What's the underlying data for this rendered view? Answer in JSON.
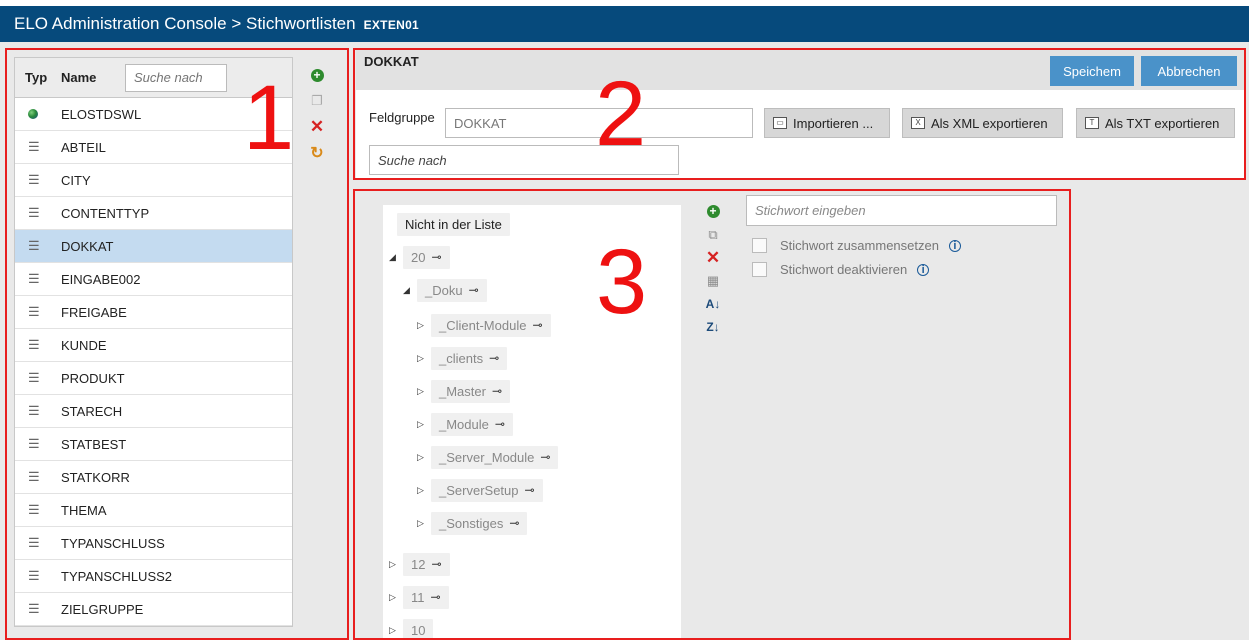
{
  "title": {
    "main": "ELO Administration Console > Stichwortlisten",
    "tenant": "EXTEN01"
  },
  "annotations": {
    "n1": "1",
    "n2": "2",
    "n3": "3"
  },
  "list": {
    "col_type": "Typ",
    "col_name": "Name",
    "search_placeholder": "Suche nach",
    "items": [
      {
        "label": "ELOSTDSWL",
        "icon": "globe-icon"
      },
      {
        "label": "ABTEIL",
        "icon": "list-icon"
      },
      {
        "label": "CITY",
        "icon": "list-icon"
      },
      {
        "label": "CONTENTTYP",
        "icon": "list-icon"
      },
      {
        "label": "DOKKAT",
        "icon": "list-icon",
        "selected": true
      },
      {
        "label": "EINGABE002",
        "icon": "list-icon"
      },
      {
        "label": "FREIGABE",
        "icon": "list-icon"
      },
      {
        "label": "KUNDE",
        "icon": "list-icon"
      },
      {
        "label": "PRODUKT",
        "icon": "list-icon"
      },
      {
        "label": "STARECH",
        "icon": "list-icon"
      },
      {
        "label": "STATBEST",
        "icon": "list-icon"
      },
      {
        "label": "STATKORR",
        "icon": "list-icon"
      },
      {
        "label": "THEMA",
        "icon": "list-icon"
      },
      {
        "label": "TYPANSCHLUSS",
        "icon": "list-icon"
      },
      {
        "label": "TYPANSCHLUSS2",
        "icon": "list-icon"
      },
      {
        "label": "ZIELGRUPPE",
        "icon": "list-icon"
      }
    ],
    "tools": [
      "add-icon",
      "copy-icon",
      "delete-icon",
      "refresh-icon"
    ]
  },
  "header": {
    "title": "DOKKAT",
    "save": "Speichem",
    "cancel": "Abbrechen",
    "fieldgroup_label": "Feldgruppe",
    "fieldgroup_value": "DOKKAT",
    "import": "Importieren ...",
    "export_xml": "Als XML exportieren",
    "export_txt": "Als TXT exportieren",
    "search_placeholder": "Suche nach"
  },
  "tree": {
    "not_in_list": "Nicht in der Liste",
    "nodes": [
      {
        "label": "20",
        "expanded": true
      },
      {
        "label": "_Doku",
        "expanded": true
      },
      {
        "label": "_Client-Module"
      },
      {
        "label": "_clients"
      },
      {
        "label": "_Master"
      },
      {
        "label": "_Module"
      },
      {
        "label": "_Server_Module"
      },
      {
        "label": "_ServerSetup"
      },
      {
        "label": "_Sonstiges"
      },
      {
        "label": "12"
      },
      {
        "label": "11"
      },
      {
        "label": "10"
      }
    ]
  },
  "keyword": {
    "placeholder": "Stichwort eingeben",
    "combine_label": "Stichwort zusammensetzen",
    "disable_label": "Stichwort deaktivieren"
  },
  "colors": {
    "titlebar": "#064a7c",
    "primary_button": "#4a92c9",
    "selected_row": "#c4dbf0",
    "annotation_red": "#e81e1e"
  }
}
